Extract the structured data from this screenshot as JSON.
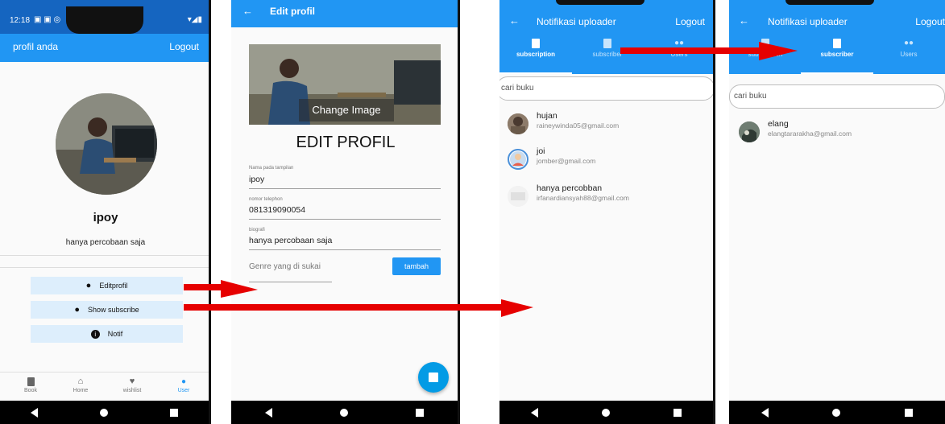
{
  "phone1": {
    "status_time": "12:18",
    "appbar_title": "profil anda",
    "logout_label": "Logout",
    "user_name": "ipoy",
    "user_bio": "hanya percobaan saja",
    "buttons": {
      "editprofil": "Editprofil",
      "show_subscribe": "Show subscribe",
      "notif": "Notif"
    },
    "bottom_nav": [
      {
        "label": "Book",
        "icon": "book-icon"
      },
      {
        "label": "Home",
        "icon": "home-icon"
      },
      {
        "label": "wishlist",
        "icon": "heart-icon"
      },
      {
        "label": "User",
        "icon": "person-icon"
      }
    ],
    "active_color": "#2196f3"
  },
  "phone2": {
    "appbar_title": "Edit profil",
    "change_image_label": "Change Image",
    "heading": "EDIT PROFIL",
    "fields": [
      {
        "label": "Nama pada tampilan",
        "value": "ipoy"
      },
      {
        "label": "nomor telephon",
        "value": "081319090054"
      },
      {
        "label": "biografi",
        "value": "hanya percobaan saja"
      }
    ],
    "genre_placeholder": "Genre yang di sukai",
    "tambah_label": "tambah"
  },
  "phone3": {
    "appbar_title": "Notifikasi uploader",
    "logout_label": "Logout",
    "tabs": [
      "subscription",
      "subscriber",
      "Users"
    ],
    "search_placeholder": "cari buku",
    "items": [
      {
        "name": "hujan",
        "email": "raineywinda05@gmail.com"
      },
      {
        "name": "joi",
        "email": "jomber@gmail.com"
      },
      {
        "name": "hanya percobban",
        "email": "irfanardiansyah88@gmail.com"
      }
    ]
  },
  "phone4": {
    "appbar_title": "Notifikasi uploader",
    "logout_label": "Logout",
    "tabs": [
      "subscription",
      "subscriber",
      "Users"
    ],
    "search_placeholder": "cari buku",
    "items": [
      {
        "name": "elang",
        "email": "elangtararakha@gmail.com"
      }
    ]
  },
  "colors": {
    "primary": "#2196f3",
    "status": "#1e88e5",
    "button_light": "#ddeefc",
    "arrow": "#e60000"
  }
}
